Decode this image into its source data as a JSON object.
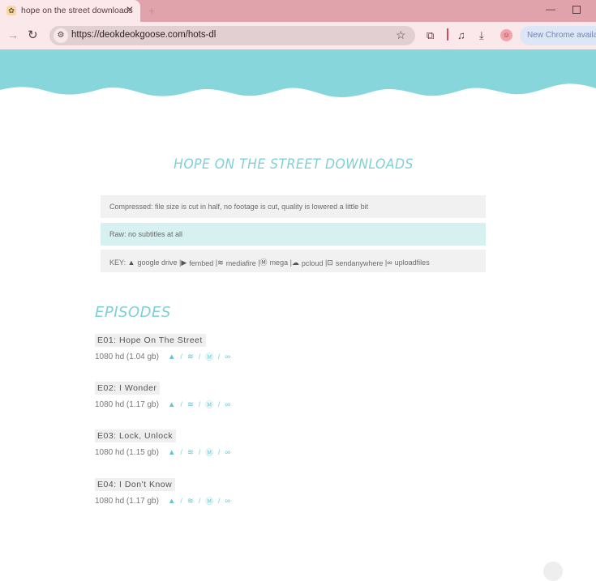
{
  "browser": {
    "tab_title": "hope on the street downloads",
    "tab_close": "✕",
    "new_tab": "+",
    "url": "https://deokdeokgoose.com/hots-dl",
    "update_button": "New Chrome available"
  },
  "page": {
    "title": "HOPE ON THE STREET DOWNLOADS",
    "compressed_note": "Compressed: file size is cut in half, no footage is cut, quality is lowered a little bit",
    "raw_note": "Raw: no subtitles at all",
    "key": {
      "label": "KEY:",
      "items": [
        {
          "icon": "google-drive-icon",
          "glyph": "▲",
          "label": "google drive"
        },
        {
          "icon": "fembed-icon",
          "glyph": "▶",
          "label": "fembed"
        },
        {
          "icon": "mediafire-icon",
          "glyph": "≋",
          "label": "mediafire"
        },
        {
          "icon": "mega-icon",
          "glyph": "Ⓜ",
          "label": "mega"
        },
        {
          "icon": "pcloud-icon",
          "glyph": "☁",
          "label": "pcloud"
        },
        {
          "icon": "sendanywhere-icon",
          "glyph": "⊡",
          "label": "sendanywhere"
        },
        {
          "icon": "uploadfiles-icon",
          "glyph": "∞",
          "label": "uploadfiles"
        }
      ],
      "separator": "|"
    },
    "episodes_heading": "EPISODES",
    "episodes": [
      {
        "title": "E01: Hope On The Street",
        "quality": "1080 hd (1.04 gb)"
      },
      {
        "title": "E02: I Wonder",
        "quality": "1080 hd (1.17 gb)"
      },
      {
        "title": "E03: Lock, Unlock",
        "quality": "1080 hd (1.15 gb)"
      },
      {
        "title": "E04: I Don't Know",
        "quality": "1080 hd (1.17 gb)"
      }
    ],
    "link_glyphs": {
      "drive": "▲",
      "mediafire": "≋",
      "mega": "Ⓜ",
      "uploadfiles": "∞",
      "separator": "/"
    }
  },
  "colors": {
    "accent": "#7fd0d6",
    "tab_bar": "#e0a3ab",
    "toolbar": "#fbe8ea"
  }
}
